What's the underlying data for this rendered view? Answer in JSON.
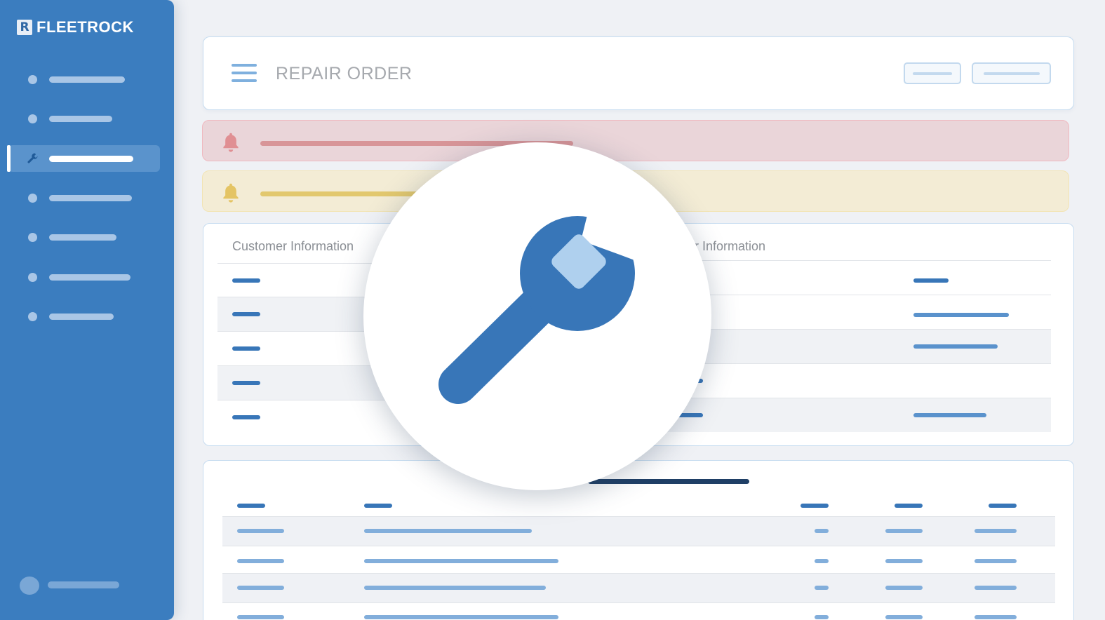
{
  "brand": {
    "logo_letter": "R",
    "name": "FLEETROCK"
  },
  "header": {
    "title": "REPAIR ORDER"
  },
  "info": {
    "customer_heading": "Customer Information",
    "repair_heading_visible": "ir Information"
  },
  "colors": {
    "sidebar": "#3b7dbf",
    "accent": "#3876b8",
    "alert_red": "#ead5d9",
    "alert_yellow": "#f3ecd5"
  },
  "icons": [
    "menu-icon",
    "wrench-icon",
    "bell-icon",
    "avatar-icon"
  ]
}
